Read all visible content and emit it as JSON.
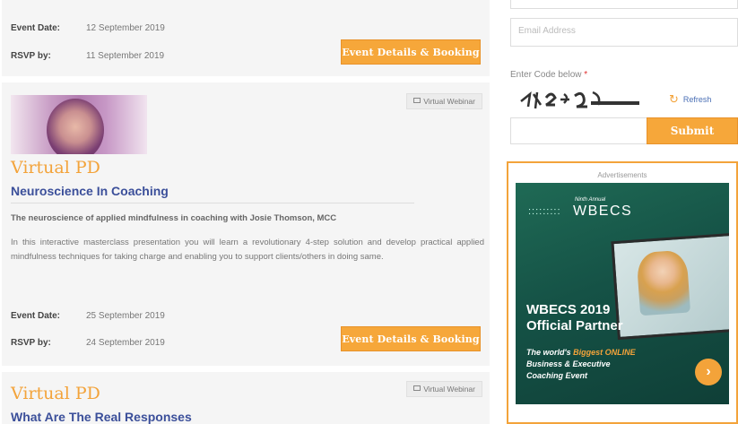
{
  "events": [
    {
      "event_date_label": "Event Date:",
      "event_date": "12 September 2019",
      "rsvp_label": "RSVP by:",
      "rsvp_date": "11 September 2019",
      "button_label": "Event Details & Booking"
    },
    {
      "tag": "Virtual Webinar",
      "category": "Virtual PD",
      "title": "Neuroscience In Coaching",
      "subtitle": "The neuroscience of applied mindfulness in coaching with Josie Thomson, MCC",
      "description": "In this interactive masterclass presentation you will learn a revolutionary 4-step solution and develop practical applied mindfulness techniques for taking charge and enabling you to support clients/others in doing same.",
      "event_date_label": "Event Date:",
      "event_date": "25 September 2019",
      "rsvp_label": "RSVP by:",
      "rsvp_date": "24 September 2019",
      "button_label": "Event Details & Booking"
    },
    {
      "tag": "Virtual Webinar",
      "category": "Virtual PD",
      "title": "What Are The Real Responses"
    }
  ],
  "sidebar": {
    "email_placeholder": "Email Address",
    "code_label": "Enter Code below",
    "required_mark": "*",
    "refresh_label": "Refresh",
    "submit_label": "Submit",
    "ad": {
      "label": "Advertisements",
      "ninth": "Ninth Annual",
      "brand": "WBECS",
      "headline_1": "WBECS 2019",
      "headline_2": "Official Partner",
      "tagline_1_pre": "The world's ",
      "tagline_1_hl": "Biggest ONLINE",
      "tagline_2": "Business & Executive",
      "tagline_3": "Coaching Event"
    }
  },
  "colors": {
    "accent_orange": "#f6a73a",
    "title_blue": "#3b4f9a",
    "ad_green": "#155246"
  }
}
